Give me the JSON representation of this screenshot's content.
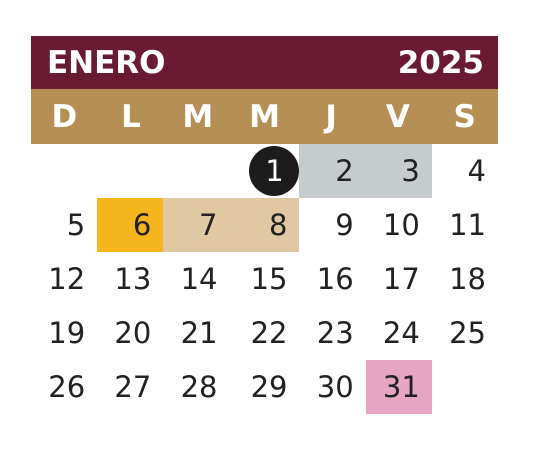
{
  "header": {
    "month": "ENERO",
    "year": "2025"
  },
  "weekdays": [
    "D",
    "L",
    "M",
    "M",
    "J",
    "V",
    "S"
  ],
  "colors": {
    "header_bg": "#6b1a34",
    "weekday_bg": "#b68f55",
    "gray_highlight": "#c6cbcd",
    "gold_highlight": "#f5b51c",
    "beige_highlight": "#dfc8a2",
    "pink_highlight": "#e6a6c3",
    "circle": "#1c1c1c"
  },
  "days": {
    "d1": "1",
    "d2": "2",
    "d3": "3",
    "d4": "4",
    "d5": "5",
    "d6": "6",
    "d7": "7",
    "d8": "8",
    "d9": "9",
    "d10": "10",
    "d11": "11",
    "d12": "12",
    "d13": "13",
    "d14": "14",
    "d15": "15",
    "d16": "16",
    "d17": "17",
    "d18": "18",
    "d19": "19",
    "d20": "20",
    "d21": "21",
    "d22": "22",
    "d23": "23",
    "d24": "24",
    "d25": "25",
    "d26": "26",
    "d27": "27",
    "d28": "28",
    "d29": "29",
    "d30": "30",
    "d31": "31"
  }
}
